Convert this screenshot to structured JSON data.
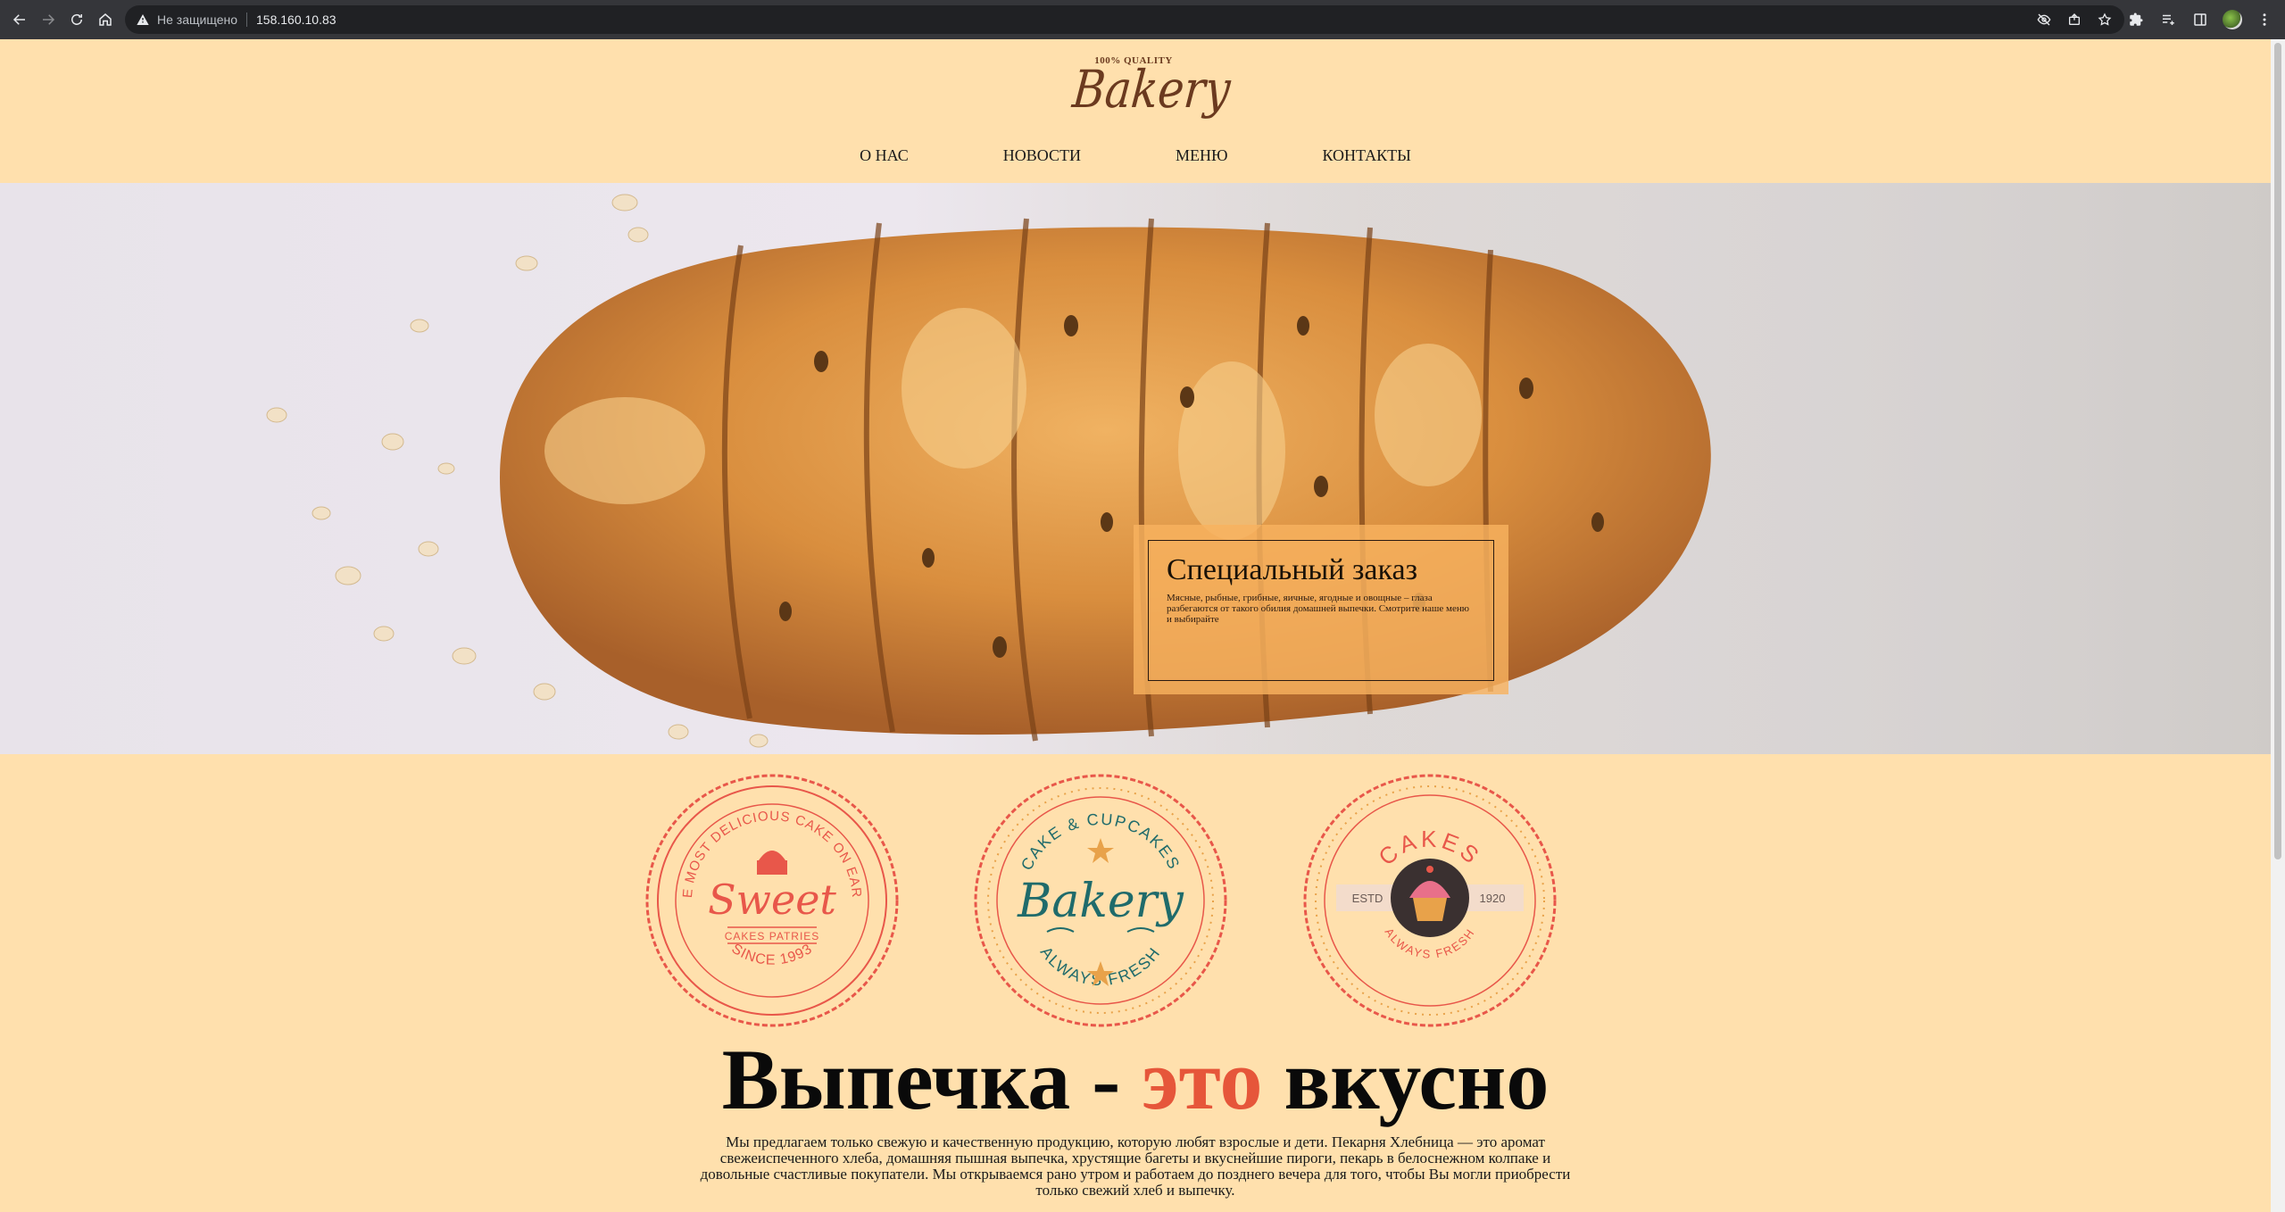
{
  "browser": {
    "security_label": "Не защищено",
    "url": "158.160.10.83",
    "icons": [
      "back-icon",
      "forward-icon",
      "reload-icon",
      "home-icon",
      "warning-icon",
      "eye-off-icon",
      "share-icon",
      "star-icon",
      "extensions-icon",
      "reading-list-icon",
      "sidebar-icon",
      "profile-avatar",
      "more-icon"
    ]
  },
  "site": {
    "logo": {
      "tagline": "100% QUALITY",
      "name": "Bakery"
    },
    "nav": [
      {
        "label": "О НАС"
      },
      {
        "label": "НОВОСТИ"
      },
      {
        "label": "МЕНЮ"
      },
      {
        "label": "КОНТАКТЫ"
      }
    ],
    "hero": {
      "title": "Специальный заказ",
      "text": "Мясные, рыбные, грибные, яичные, ягодные и овощные – глаза разбегаются от такого обилия домашней выпечки. Смотрите наше меню и выбирайте"
    },
    "badges": [
      {
        "top": "THE MOST DELICIOUS CAKE ON EARTH",
        "main": "Sweet",
        "ribbon": "CAKES PATRIES",
        "bottom": "SINCE 1993"
      },
      {
        "top": "CAKE & CUPCAKES",
        "main": "Bakery",
        "bottom": "ALWAYS FRESH"
      },
      {
        "top": "CAKES",
        "left": "ESTD",
        "right": "1920",
        "bottom": "ALWAYS FRESH"
      }
    ],
    "headline": {
      "part1": "Выпечка - ",
      "accent": "это",
      "part2": " вкусно"
    },
    "lead": "Мы предлагаем только свежую и качественную продукцию, которую любят взрослые и дети. Пекарня Хлебница — это аромат свежеиспеченного хлеба, домашняя пышная выпечка, хрустящие багеты и вкуснейшие пироги, пекарь в белоснежном колпаке и довольные счастливые покупатели. Мы открываемся рано утром и работаем до позднего вечера для того, чтобы Вы могли приобрести только свежий хлеб и выпечку.",
    "colors": {
      "background": "#ffe0ad",
      "accent": "#e6563a",
      "brand_brown": "#6b3a1f",
      "badge_red": "#e8574a",
      "badge_teal": "#1f6b6b"
    }
  }
}
